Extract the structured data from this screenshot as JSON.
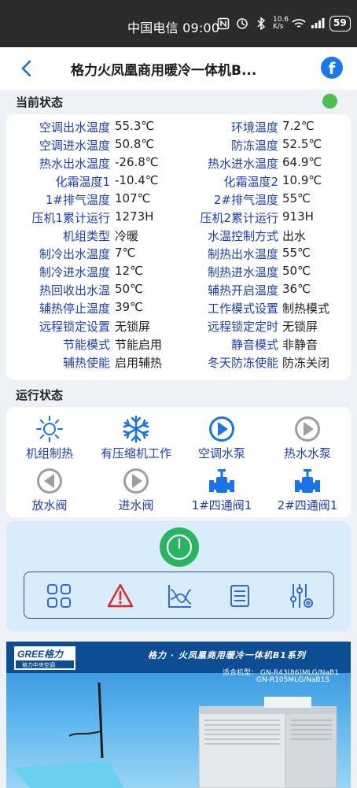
{
  "statusbar": {
    "carrier_time": "中国电信 09:00",
    "speed": "10.6\nK/s",
    "battery": "59"
  },
  "header": {
    "title": "格力火凤凰商用暖冷一体机B..."
  },
  "current_status": {
    "title": "当前状态",
    "rows": [
      {
        "l1": "空调出水温度",
        "v1": "55.3℃",
        "l2": "环境温度",
        "v2": "7.2℃"
      },
      {
        "l1": "空调进水温度",
        "v1": "50.8℃",
        "l2": "防冻温度",
        "v2": "52.5℃"
      },
      {
        "l1": "热水出水温度",
        "v1": "-26.8℃",
        "l2": "热水进水温度",
        "v2": "64.9℃"
      },
      {
        "l1": "化霜温度1",
        "v1": "-10.4℃",
        "l2": "化霜温度2",
        "v2": "10.9℃"
      },
      {
        "l1": "1#排气温度",
        "v1": "107℃",
        "l2": "2#排气温度",
        "v2": "55℃"
      },
      {
        "l1": "压机1累计运行",
        "v1": "1273H",
        "l2": "压机2累计运行",
        "v2": "913H"
      },
      {
        "l1": "机组类型",
        "v1": "冷暖",
        "l2": "水温控制方式",
        "v2": "出水"
      },
      {
        "l1": "制冷出水温度",
        "v1": "7℃",
        "l2": "制热出水温度",
        "v2": "55℃"
      },
      {
        "l1": "制冷进水温度",
        "v1": "12℃",
        "l2": "制热进水温度",
        "v2": "50℃"
      },
      {
        "l1": "热回收出水温",
        "v1": "50℃",
        "l2": "辅热开启温度",
        "v2": "36℃"
      },
      {
        "l1": "辅热停止温度",
        "v1": "39℃",
        "l2": "工作模式设置",
        "v2": "制热模式"
      },
      {
        "l1": "远程锁定设置",
        "v1": "无锁屏",
        "l2": "远程锁定定时",
        "v2": "无锁屏"
      },
      {
        "l1": "节能模式",
        "v1": "节能启用",
        "l2": "静音模式",
        "v2": "非静音"
      },
      {
        "l1": "辅热使能",
        "v1": "启用辅热",
        "l2": "冬天防冻使能",
        "v2": "防冻关闭"
      }
    ]
  },
  "run_status": {
    "title": "运行状态",
    "items": [
      {
        "label": "机组制热",
        "icon": "sun-icon"
      },
      {
        "label": "有压缩机工作",
        "icon": "snowflake-icon"
      },
      {
        "label": "空调水泵",
        "icon": "pump-active-icon"
      },
      {
        "label": "热水水泵",
        "icon": "pump-inactive-icon"
      },
      {
        "label": "放水阀",
        "icon": "valve-left-icon"
      },
      {
        "label": "进水阀",
        "icon": "valve-right-icon"
      },
      {
        "label": "1#四通阀1",
        "icon": "four-way-valve-icon"
      },
      {
        "label": "2#四通阀1",
        "icon": "four-way-valve-icon"
      }
    ]
  },
  "banner": {
    "brand": "GREE格力",
    "brand_sub": "格力中央空调",
    "title": "格力 · 火凤凰商用暖冷一体机B1系列",
    "label": "适合机型：",
    "model1": "GN-R43(86)MLG/NaB1",
    "model2": "GN-R105MLG/NaB1S"
  },
  "colors": {
    "label_blue": "#1c3fbf",
    "status_green": "#4fbe4f",
    "power_green": "#28b463",
    "header_dark": "#2b2b2b"
  }
}
